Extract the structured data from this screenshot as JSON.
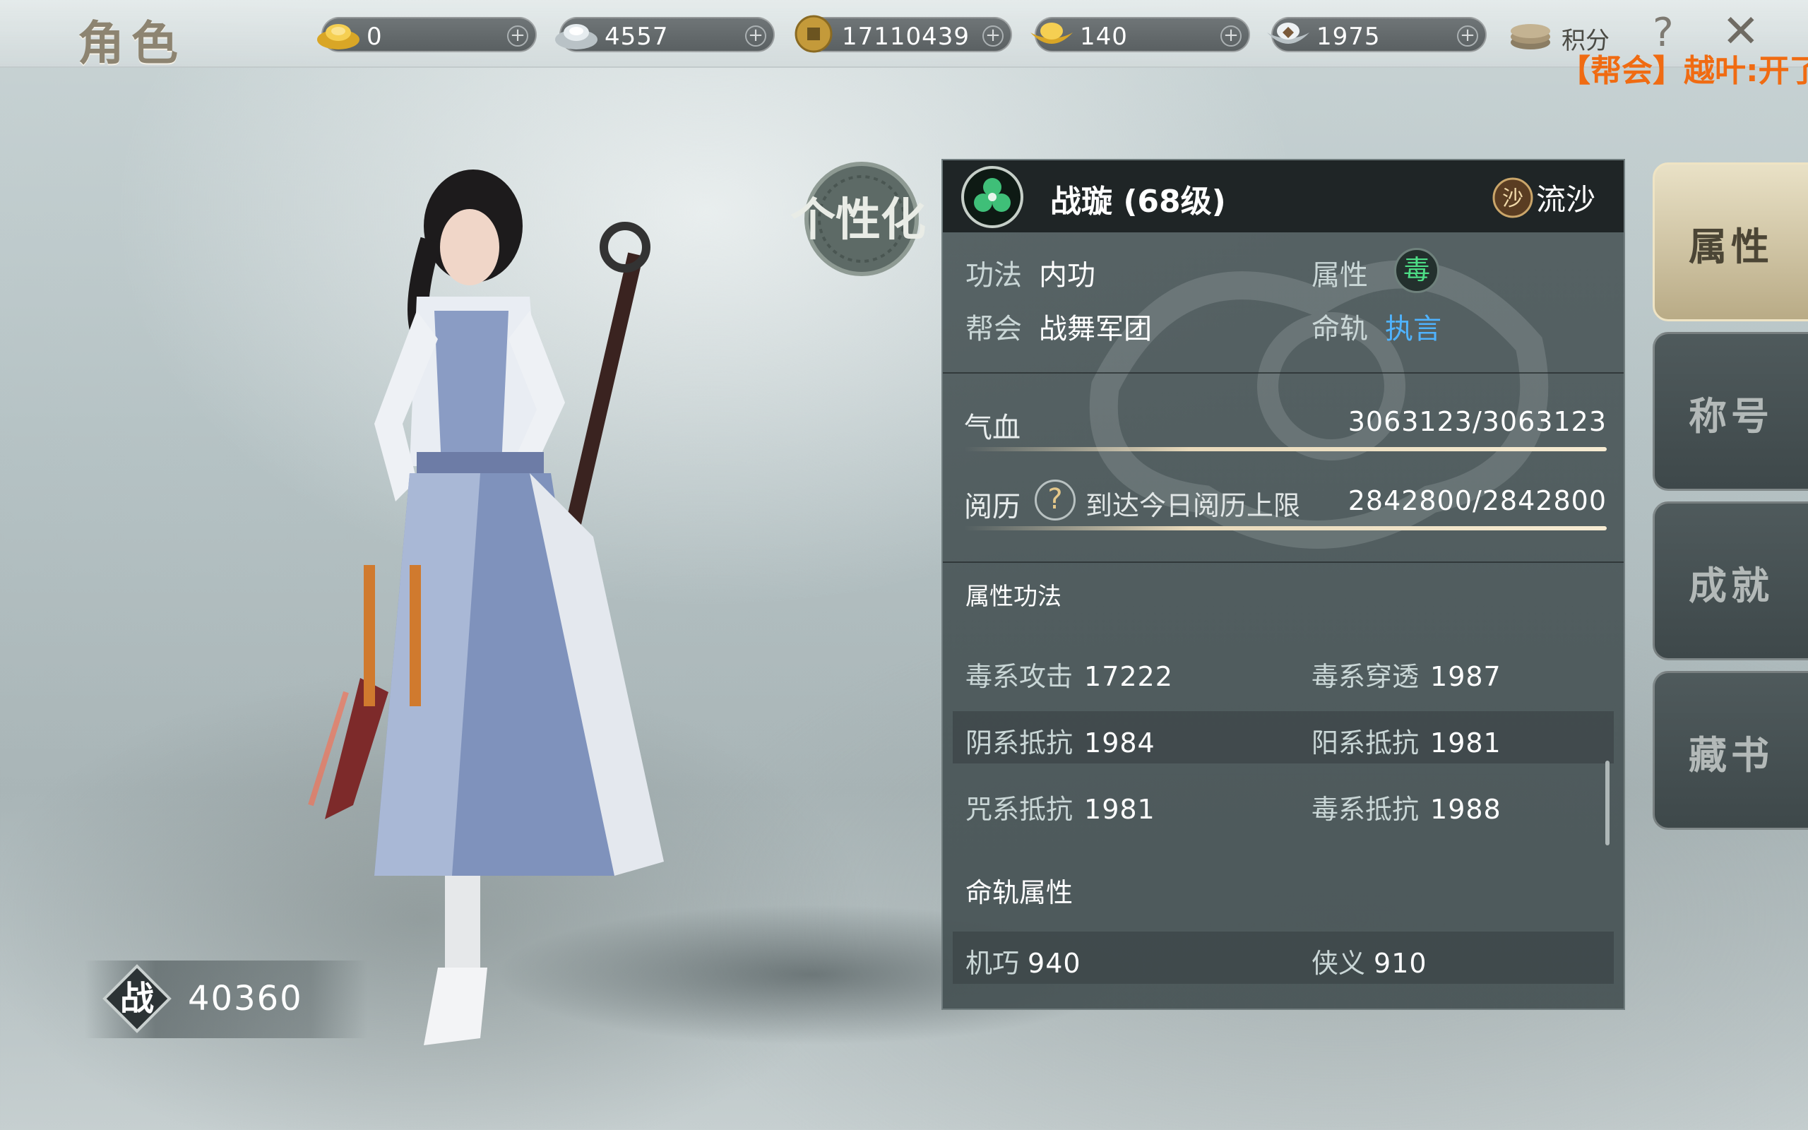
{
  "window": {
    "title": "角色"
  },
  "currencies": [
    {
      "icon": "gold-ingot-icon",
      "value": "0"
    },
    {
      "icon": "silver-ingot-icon",
      "value": "4557"
    },
    {
      "icon": "copper-coin-icon",
      "value": "17110439"
    },
    {
      "icon": "gold-boat-ingot-icon",
      "value": "140"
    },
    {
      "icon": "silver-boat-ingot-icon",
      "value": "1975"
    }
  ],
  "topbar": {
    "score_label": "积分",
    "help_glyph": "?",
    "close_glyph": "✕",
    "chat_ticker": "【帮会】越叶:开了"
  },
  "character": {
    "personalize_label": "个性化",
    "power_icon": "战",
    "power_value": "40360"
  },
  "panel": {
    "name": "战璇 (68级)",
    "server_icon": "沙",
    "server": "流沙",
    "info": {
      "skill_key": "功法",
      "skill_val": "内功",
      "attr_key": "属性",
      "attr_badge": "毒",
      "guild_key": "帮会",
      "guild_val": "战舞军团",
      "fate_key": "命轨",
      "fate_val": "执言"
    },
    "hp": {
      "label": "气血",
      "value": "3063123/3063123",
      "fill": 1.0
    },
    "exp": {
      "label": "阅历",
      "hint_glyph": "?",
      "hint": "到达今日阅历上限",
      "value": "2842800/2842800",
      "fill": 1.0
    },
    "sections": {
      "attr_title": "属性功法",
      "fate_title": "命轨属性"
    },
    "attributes": [
      [
        {
          "name": "毒系攻击",
          "value": "17222"
        },
        {
          "name": "毒系穿透",
          "value": "1987"
        }
      ],
      [
        {
          "name": "阴系抵抗",
          "value": "1984"
        },
        {
          "name": "阳系抵抗",
          "value": "1981"
        }
      ],
      [
        {
          "name": "咒系抵抗",
          "value": "1981"
        },
        {
          "name": "毒系抵抗",
          "value": "1988"
        }
      ]
    ],
    "fate_attributes": [
      {
        "name": "机巧",
        "value": "940"
      },
      {
        "name": "侠义",
        "value": "910"
      }
    ]
  },
  "tabs": [
    {
      "label": "属性",
      "active": true
    },
    {
      "label": "称号",
      "active": false
    },
    {
      "label": "成就",
      "active": false
    },
    {
      "label": "藏书",
      "active": false
    }
  ],
  "colors": {
    "accent_link": "#4fb3ff",
    "poison_green": "#4dde86",
    "chat_orange": "#f06b12",
    "panel_bg": "#4e5a5c"
  }
}
